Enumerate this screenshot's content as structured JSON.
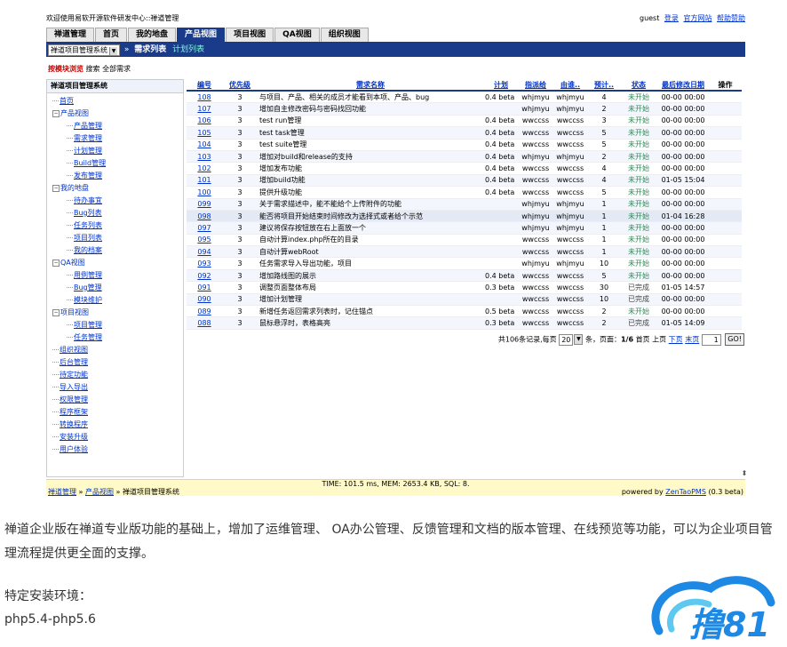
{
  "top": {
    "welcome": "欢迎使用易软开源软件研发中心::禅道管理",
    "user": "guest",
    "links": [
      "登录",
      "官方网站",
      "帮助赞助"
    ]
  },
  "mainnav": {
    "tabs": [
      "禅道管理",
      "首页",
      "我的地盘",
      "产品视图",
      "项目视图",
      "QA视图",
      "组织视图"
    ],
    "active_index": 3
  },
  "subnav": {
    "product_select": "禅道项目管理系统",
    "sep": "»",
    "current": "需求列表",
    "other": "计划列表"
  },
  "browse": {
    "label": "按模块浏览",
    "search": "搜索",
    "all": "全部需求"
  },
  "sidebar": {
    "title": "禅道项目管理系统",
    "items": [
      {
        "label": "首页",
        "level": 1,
        "type": "leaf"
      },
      {
        "label": "产品视图",
        "level": 1,
        "type": "node"
      },
      {
        "label": "产品管理",
        "level": 2,
        "type": "leaf"
      },
      {
        "label": "需求管理",
        "level": 2,
        "type": "leaf"
      },
      {
        "label": "计划管理",
        "level": 2,
        "type": "leaf"
      },
      {
        "label": "Build管理",
        "level": 2,
        "type": "leaf"
      },
      {
        "label": "发布管理",
        "level": 2,
        "type": "leaf"
      },
      {
        "label": "我的地盘",
        "level": 1,
        "type": "node"
      },
      {
        "label": "待办事宜",
        "level": 2,
        "type": "leaf"
      },
      {
        "label": "Bug列表",
        "level": 2,
        "type": "leaf"
      },
      {
        "label": "任务列表",
        "level": 2,
        "type": "leaf"
      },
      {
        "label": "项目列表",
        "level": 2,
        "type": "leaf"
      },
      {
        "label": "我的档案",
        "level": 2,
        "type": "leaf"
      },
      {
        "label": "QA视图",
        "level": 1,
        "type": "node"
      },
      {
        "label": "用例管理",
        "level": 2,
        "type": "leaf"
      },
      {
        "label": "Bug管理",
        "level": 2,
        "type": "leaf"
      },
      {
        "label": "模块维护",
        "level": 2,
        "type": "leaf"
      },
      {
        "label": "项目视图",
        "level": 1,
        "type": "node"
      },
      {
        "label": "项目管理",
        "level": 2,
        "type": "leaf"
      },
      {
        "label": "任务管理",
        "level": 2,
        "type": "leaf"
      },
      {
        "label": "组织视图",
        "level": 1,
        "type": "leaf"
      },
      {
        "label": "后台管理",
        "level": 1,
        "type": "leaf"
      },
      {
        "label": "待定功能",
        "level": 1,
        "type": "leaf"
      },
      {
        "label": "导入导出",
        "level": 1,
        "type": "leaf"
      },
      {
        "label": "权限管理",
        "level": 1,
        "type": "leaf"
      },
      {
        "label": "程序框架",
        "level": 1,
        "type": "leaf"
      },
      {
        "label": "转换程序",
        "level": 1,
        "type": "leaf"
      },
      {
        "label": "安装升级",
        "level": 1,
        "type": "leaf"
      },
      {
        "label": "用户体验",
        "level": 1,
        "type": "leaf"
      }
    ]
  },
  "table": {
    "headers": [
      "编号",
      "优先级",
      "需求名称",
      "计划",
      "指派给",
      "由谁..",
      "预计..",
      "状态",
      "最后修改日期",
      "操作"
    ],
    "rows": [
      {
        "id": "108",
        "pri": "3",
        "title": "与项目、产品、相关的成员才能看到本项、产品、bug",
        "plan": "0.4 beta",
        "assigned": "whjmyu",
        "by": "whjmyu",
        "est": "4",
        "status": "未开始",
        "date": "00-00 00:00"
      },
      {
        "id": "107",
        "pri": "3",
        "title": "增加自主修改密码与密码找回功能",
        "plan": "",
        "assigned": "whjmyu",
        "by": "whjmyu",
        "est": "2",
        "status": "未开始",
        "date": "00-00 00:00"
      },
      {
        "id": "106",
        "pri": "3",
        "title": "test run管理",
        "plan": "0.4 beta",
        "assigned": "wwccss",
        "by": "wwccss",
        "est": "3",
        "status": "未开始",
        "date": "00-00 00:00"
      },
      {
        "id": "105",
        "pri": "3",
        "title": "test task管理",
        "plan": "0.4 beta",
        "assigned": "wwccss",
        "by": "wwccss",
        "est": "5",
        "status": "未开始",
        "date": "00-00 00:00"
      },
      {
        "id": "104",
        "pri": "3",
        "title": "test suite管理",
        "plan": "0.4 beta",
        "assigned": "wwccss",
        "by": "wwccss",
        "est": "5",
        "status": "未开始",
        "date": "00-00 00:00"
      },
      {
        "id": "103",
        "pri": "3",
        "title": "增加对build和release的支持",
        "plan": "0.4 beta",
        "assigned": "whjmyu",
        "by": "whjmyu",
        "est": "2",
        "status": "未开始",
        "date": "00-00 00:00"
      },
      {
        "id": "102",
        "pri": "3",
        "title": "增加发布功能",
        "plan": "0.4 beta",
        "assigned": "wwccss",
        "by": "wwccss",
        "est": "4",
        "status": "未开始",
        "date": "00-00 00:00"
      },
      {
        "id": "101",
        "pri": "3",
        "title": "增加build功能",
        "plan": "0.4 beta",
        "assigned": "wwccss",
        "by": "wwccss",
        "est": "4",
        "status": "未开始",
        "date": "01-05 15:04"
      },
      {
        "id": "100",
        "pri": "3",
        "title": "提供升级功能",
        "plan": "0.4 beta",
        "assigned": "wwccss",
        "by": "wwccss",
        "est": "5",
        "status": "未开始",
        "date": "00-00 00:00"
      },
      {
        "id": "099",
        "pri": "3",
        "title": "关于需求描述中，能不能给个上传附件的功能",
        "plan": "",
        "assigned": "whjmyu",
        "by": "whjmyu",
        "est": "1",
        "status": "未开始",
        "date": "00-00 00:00"
      },
      {
        "id": "098",
        "pri": "3",
        "title": "能否将项目开始结束时间修改为选择式或者给个示范",
        "plan": "",
        "assigned": "whjmyu",
        "by": "whjmyu",
        "est": "1",
        "status": "未开始",
        "date": "01-04 16:28"
      },
      {
        "id": "097",
        "pri": "3",
        "title": "建议将保存按钮放在右上面放一个",
        "plan": "",
        "assigned": "whjmyu",
        "by": "whjmyu",
        "est": "1",
        "status": "未开始",
        "date": "00-00 00:00"
      },
      {
        "id": "095",
        "pri": "3",
        "title": "自动计算index.php所在的目录",
        "plan": "",
        "assigned": "wwccss",
        "by": "wwccss",
        "est": "1",
        "status": "未开始",
        "date": "00-00 00:00"
      },
      {
        "id": "094",
        "pri": "3",
        "title": "自动计算webRoot",
        "plan": "",
        "assigned": "wwccss",
        "by": "wwccss",
        "est": "1",
        "status": "未开始",
        "date": "00-00 00:00"
      },
      {
        "id": "093",
        "pri": "3",
        "title": "任务需求导入导出功能，项目",
        "plan": "",
        "assigned": "whjmyu",
        "by": "whjmyu",
        "est": "10",
        "status": "未开始",
        "date": "00-00 00:00"
      },
      {
        "id": "092",
        "pri": "3",
        "title": "增加路线图的展示",
        "plan": "0.4 beta",
        "assigned": "wwccss",
        "by": "wwccss",
        "est": "5",
        "status": "未开始",
        "date": "00-00 00:00"
      },
      {
        "id": "091",
        "pri": "3",
        "title": "调整页面整体布局",
        "plan": "0.3 beta",
        "assigned": "wwccss",
        "by": "wwccss",
        "est": "30",
        "status": "已完成",
        "date": "01-05 14:57"
      },
      {
        "id": "090",
        "pri": "3",
        "title": "增加计划管理",
        "plan": "",
        "assigned": "wwccss",
        "by": "wwccss",
        "est": "10",
        "status": "已完成",
        "date": "00-00 00:00"
      },
      {
        "id": "089",
        "pri": "3",
        "title": "新增任务返回需求列表时，记住锚点",
        "plan": "0.5 beta",
        "assigned": "wwccss",
        "by": "wwccss",
        "est": "2",
        "status": "未开始",
        "date": "00-00 00:00"
      },
      {
        "id": "088",
        "pri": "3",
        "title": "鼠标悬浮时，表格高亮",
        "plan": "0.3 beta",
        "assigned": "wwccss",
        "by": "wwccss",
        "est": "2",
        "status": "已完成",
        "date": "01-05 14:09"
      }
    ]
  },
  "pager": {
    "total_text": "共106条记录,每页",
    "per_page": "20",
    "unit_text": "条，页面：",
    "page_info": "1/6",
    "first": "首页",
    "prev": "上页",
    "next": "下页",
    "last": "末页",
    "page_input": "1",
    "go": "GO!"
  },
  "footer": {
    "stats": "TIME: 101.5 ms, MEM: 2653.4 KB, SQL: 8.",
    "crumb_1": "禅道管理",
    "crumb_2": "产品视图",
    "crumb_3": "禅道项目管理系统",
    "sep": "»",
    "powered_prefix": "powered by",
    "powered_link": "ZenTaoPMS",
    "version": "(0.3 beta)"
  },
  "article": {
    "paragraph": "禅道企业版在禅道专业版功能的基础上，增加了运维管理、 OA办公管理、反馈管理和文档的版本管理、在线预览等功能，可以为企业项目管理流程提供更全面的支撑。",
    "env_label": "特定安装环境：",
    "php": "php5.4-php5.6"
  },
  "logo": {
    "text": "撸81",
    "color": "#1e88e5"
  }
}
